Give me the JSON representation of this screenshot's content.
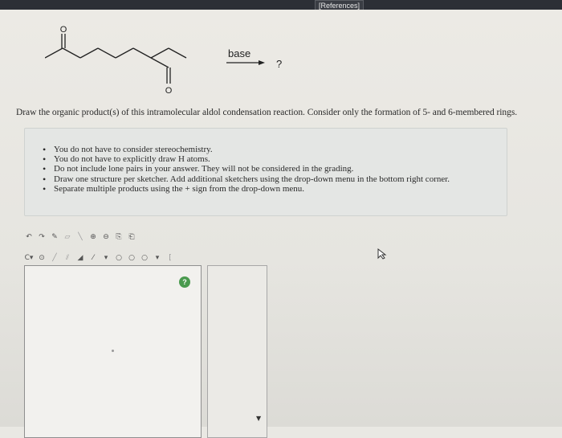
{
  "header": {
    "references_label": "[References]"
  },
  "reaction": {
    "reagent_label": "base",
    "product_label": "?",
    "oxygen_top": "O",
    "oxygen_bottom": "O"
  },
  "question": {
    "text": "Draw the organic product(s) of this intramolecular aldol condensation reaction. Consider only the formation of 5- and 6-membered rings."
  },
  "instructions": {
    "items": [
      "You do not have to consider stereochemistry.",
      "You do not have to explicitly draw H atoms.",
      "Do not include lone pairs in your answer. They will not be considered in the grading.",
      "Draw one structure per sketcher. Add additional sketchers using the drop-down menu in the bottom right corner.",
      "Separate multiple products using the + sign from the drop-down menu."
    ]
  },
  "sketcher": {
    "help_label": "?"
  },
  "icons": {
    "toolbar_row1": [
      "undo-icon",
      "redo-icon",
      "pencil-icon",
      "eraser-icon",
      "bond-icon",
      "zoom-in-icon",
      "zoom-out-icon",
      "copy-icon",
      "paste-icon"
    ],
    "toolbar_row2": [
      "atom-dropdown-icon",
      "charge-icon",
      "single-bond-icon",
      "double-bond-icon",
      "wedge-bond-icon",
      "chain-icon",
      "bond-dropdown-icon",
      "ring-icon",
      "ring-icon",
      "ring-icon",
      "ring-dropdown-icon",
      "template-icon"
    ],
    "accent_green": "#4a9a4e"
  }
}
